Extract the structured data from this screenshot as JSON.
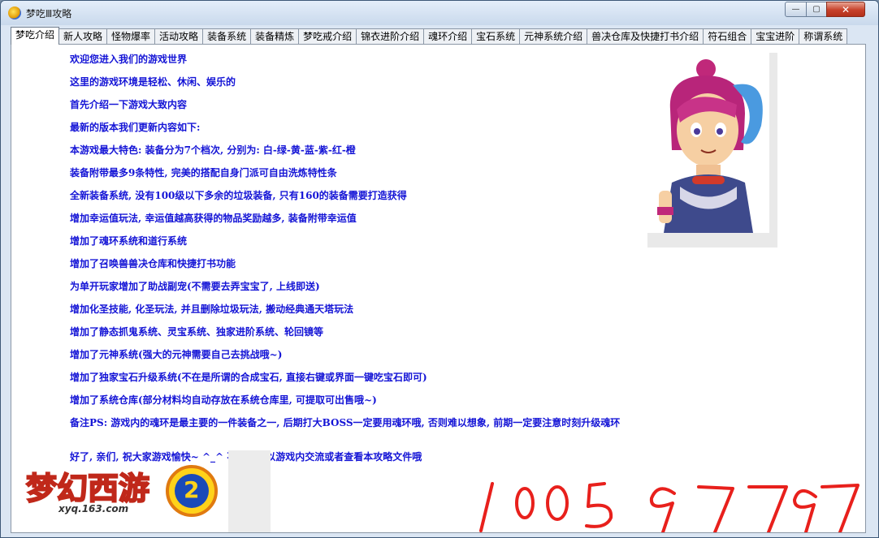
{
  "window": {
    "title": "梦吃Ⅲ攻略",
    "buttons": {
      "minimize": "—",
      "maximize": "▢",
      "close": "✕"
    }
  },
  "tabs": [
    {
      "label": "梦吃介绍",
      "active": true
    },
    {
      "label": "新人攻略"
    },
    {
      "label": "怪物爆率"
    },
    {
      "label": "活动攻略"
    },
    {
      "label": "装备系统"
    },
    {
      "label": "装备精炼"
    },
    {
      "label": "梦吃戒介绍"
    },
    {
      "label": "锦衣进阶介绍"
    },
    {
      "label": "魂环介绍"
    },
    {
      "label": "宝石系统"
    },
    {
      "label": "元神系统介绍"
    },
    {
      "label": "兽决仓库及快捷打书介绍"
    },
    {
      "label": "符石组合"
    },
    {
      "label": "宝宝进阶"
    },
    {
      "label": "称谓系统"
    }
  ],
  "content": {
    "lines": [
      "欢迎您进入我们的游戏世界",
      "这里的游戏环境是轻松、休闲、娱乐的",
      "首先介绍一下游戏大致内容",
      "最新的版本我们更新内容如下:",
      "本游戏最大特色: 装备分为7个档次, 分别为: 白-绿-黄-蓝-紫-红-橙",
      "装备附带最多9条特性, 完美的搭配自身门派可自由洗炼特性条",
      "全新装备系统, 没有100级以下多余的垃圾装备, 只有160的装备需要打造获得",
      "增加幸运值玩法, 幸运值越高获得的物品奖励越多, 装备附带幸运值",
      "增加了魂环系统和道行系统",
      "增加了召唤兽兽决仓库和快捷打书功能",
      "为单开玩家增加了助战副宠(不需要去弄宝宝了, 上线即送)",
      "增加化圣技能, 化圣玩法, 并且删除垃圾玩法, 搬动经典通天塔玩法",
      "增加了静态抓鬼系统、灵宝系统、独家进阶系统、轮回镜等",
      "增加了元神系统(强大的元神需要自己去挑战哦~)",
      "增加了独家宝石升级系统(不在是所谓的合成宝石, 直接右键或界面一键吃宝石即可)",
      "增加了系统仓库(部分材料均自动存放在系统仓库里, 可提取可出售哦~)",
      "备注PS: 游戏内的魂环是最主要的一件装备之一, 后期打大BOSS一定要用魂环哦, 否则难以想象, 前期一定要注意时刻升级魂环",
      "好了, 亲们, 祝大家游戏愉快~ ^_^ 不懂得可以游戏内交流或者查看本攻略文件哦"
    ]
  },
  "logo": {
    "url_text": "xyq.163.com",
    "badge": "2"
  },
  "handwriting": {
    "text": "1005 97797",
    "color": "#e8201c"
  },
  "colors": {
    "text": "#1414d6",
    "background": "#ffffff"
  }
}
